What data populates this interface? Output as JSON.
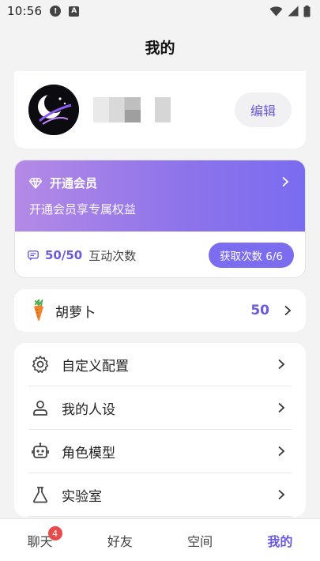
{
  "status_bar": {
    "time": "10:56",
    "icons": [
      "alert-icon",
      "a-icon",
      "wifi-icon",
      "signal-icon",
      "battery-icon"
    ]
  },
  "header": {
    "title": "我的"
  },
  "profile": {
    "edit_label": "编辑"
  },
  "vip": {
    "title": "开通会员",
    "subtitle": "开通会员享专属权益",
    "count": "50/50",
    "count_label": "互动次数",
    "get_button": "获取次数 6/6"
  },
  "carrot": {
    "label": "胡萝卜",
    "value": "50"
  },
  "menu": {
    "items": [
      {
        "label": "自定义配置",
        "icon": "gear-icon"
      },
      {
        "label": "我的人设",
        "icon": "person-icon"
      },
      {
        "label": "角色模型",
        "icon": "robot-icon"
      },
      {
        "label": "实验室",
        "icon": "flask-icon"
      }
    ]
  },
  "tabs": [
    {
      "label": "聊天",
      "badge": "4"
    },
    {
      "label": "好友"
    },
    {
      "label": "空间"
    },
    {
      "label": "我的"
    }
  ],
  "colors": {
    "accent": "#6a5ae0",
    "vip_gradient_start": "#b48ae6",
    "vip_gradient_end": "#7a6cf0",
    "badge": "#e94b4b"
  }
}
